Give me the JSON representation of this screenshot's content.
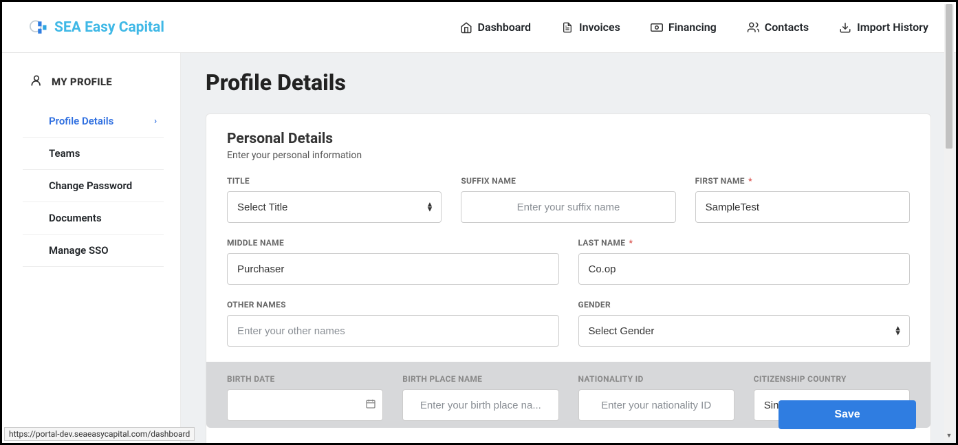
{
  "brand": "SEA Easy Capital",
  "topnav": [
    {
      "icon": "home-icon",
      "label": "Dashboard"
    },
    {
      "icon": "invoice-icon",
      "label": "Invoices"
    },
    {
      "icon": "financing-icon",
      "label": "Financing"
    },
    {
      "icon": "contacts-icon",
      "label": "Contacts"
    },
    {
      "icon": "import-icon",
      "label": "Import History"
    }
  ],
  "sidebar": {
    "header": "MY PROFILE",
    "items": [
      {
        "label": "Profile Details",
        "active": true,
        "chevron": true
      },
      {
        "label": "Teams"
      },
      {
        "label": "Change Password"
      },
      {
        "label": "Documents"
      },
      {
        "label": "Manage SSO"
      }
    ]
  },
  "page": {
    "title": "Profile Details",
    "section_title": "Personal Details",
    "section_sub": "Enter your personal information"
  },
  "fields": {
    "title": {
      "label": "TITLE",
      "value": "Select Title"
    },
    "suffix": {
      "label": "SUFFIX NAME",
      "placeholder": "Enter your suffix name",
      "value": ""
    },
    "first_name": {
      "label": "FIRST NAME",
      "value": "SampleTest",
      "required": true
    },
    "middle_name": {
      "label": "MIDDLE NAME",
      "value": "Purchaser"
    },
    "last_name": {
      "label": "LAST NAME",
      "value": "Co.op",
      "required": true
    },
    "other_names": {
      "label": "OTHER NAMES",
      "placeholder": "Enter your other names",
      "value": ""
    },
    "gender": {
      "label": "GENDER",
      "value": "Select Gender"
    },
    "birth_date": {
      "label": "BIRTH DATE",
      "value": ""
    },
    "birth_place": {
      "label": "BIRTH PLACE NAME",
      "placeholder": "Enter your birth place na...",
      "value": ""
    },
    "nationality": {
      "label": "NATIONALITY ID",
      "placeholder": "Enter your nationality ID",
      "value": ""
    },
    "citizenship": {
      "label": "CITIZENSHIP COUNTRY",
      "value": "Singa"
    }
  },
  "buttons": {
    "save": "Save"
  },
  "status_url": "https://portal-dev.seaeasycapital.com/dashboard",
  "required_mark": "*"
}
